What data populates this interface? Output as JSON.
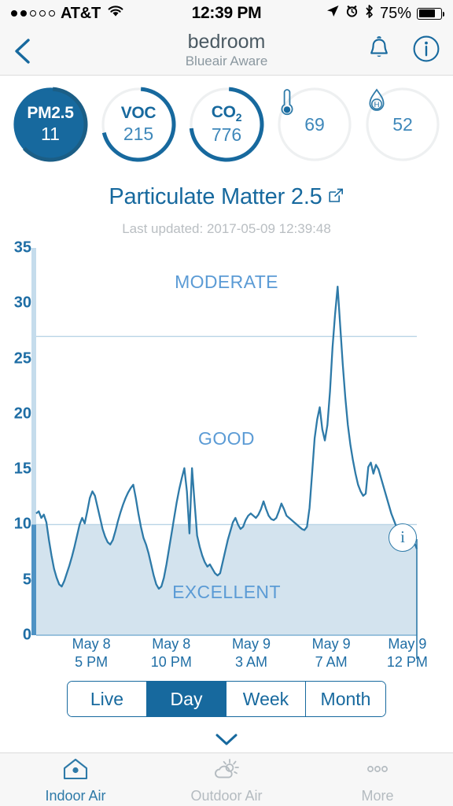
{
  "status_bar": {
    "carrier": "AT&T",
    "signal_dots_filled": 2,
    "signal_dots_total": 5,
    "time": "12:39 PM",
    "battery_percent": "75%",
    "battery_level": 75,
    "icons": [
      "location-arrow-icon",
      "alarm-clock-icon",
      "bluetooth-icon",
      "battery-icon"
    ]
  },
  "header": {
    "back_label": "",
    "title": "bedroom",
    "subtitle": "Blueair Aware",
    "bell_label": "",
    "info_label": ""
  },
  "metrics": [
    {
      "label": "PM2.5",
      "value": "11",
      "active": true,
      "arc": 0.62,
      "icon": null
    },
    {
      "label": "VOC",
      "value": "215",
      "active": false,
      "arc": 0.7,
      "icon": null
    },
    {
      "label": "CO",
      "sub": "2",
      "value": "776",
      "active": false,
      "arc": 0.72,
      "icon": null
    },
    {
      "label": "",
      "value": "69",
      "active": false,
      "arc": 0,
      "icon": "thermometer-icon"
    },
    {
      "label": "",
      "value": "52",
      "active": false,
      "arc": 0,
      "icon": "humidity-droplet-icon"
    }
  ],
  "chart_header": {
    "title": "Particulate Matter 2.5",
    "external_link_icon": "external-link-icon",
    "last_updated": "Last updated: 2017-05-09 12:39:48"
  },
  "chart_data": {
    "type": "area",
    "title": "Particulate Matter 2.5",
    "xlabel": "",
    "ylabel": "",
    "ylim": [
      0,
      35
    ],
    "yticks": [
      0,
      5,
      10,
      15,
      20,
      25,
      30,
      35
    ],
    "grid": true,
    "gridlines": [
      10,
      27
    ],
    "xtick_labels": [
      {
        "date": "May 8",
        "time": "5 PM",
        "x": 0.145
      },
      {
        "date": "May 8",
        "time": "10 PM",
        "x": 0.355
      },
      {
        "date": "May 9",
        "time": "3 AM",
        "x": 0.565
      },
      {
        "date": "May 9",
        "time": "7 AM",
        "x": 0.775
      },
      {
        "date": "May 9",
        "time": "12 PM",
        "x": 0.975
      }
    ],
    "bands": [
      {
        "label": "MODERATE",
        "min": 27,
        "max": 35
      },
      {
        "label": "GOOD",
        "min": 10,
        "max": 27
      },
      {
        "label": "EXCELLENT",
        "min": 0,
        "max": 10
      }
    ],
    "series_name": "PM2.5",
    "values": [
      11.0,
      11.2,
      10.6,
      10.9,
      10.2,
      8.6,
      7.2,
      6.0,
      5.2,
      4.6,
      4.4,
      4.9,
      5.6,
      6.3,
      7.1,
      8.0,
      9.0,
      10.0,
      10.6,
      10.1,
      11.2,
      12.4,
      13.0,
      12.6,
      11.6,
      10.6,
      9.6,
      8.9,
      8.4,
      8.2,
      8.6,
      9.4,
      10.3,
      11.1,
      11.8,
      12.4,
      12.9,
      13.3,
      13.6,
      12.4,
      11.0,
      9.8,
      8.8,
      8.2,
      7.4,
      6.4,
      5.4,
      4.6,
      4.2,
      4.4,
      5.2,
      6.4,
      7.8,
      9.2,
      10.6,
      12.0,
      13.2,
      14.2,
      15.1,
      13.0,
      9.2,
      15.1,
      12.0,
      9.0,
      8.0,
      7.2,
      6.6,
      6.2,
      6.4,
      6.0,
      5.6,
      5.4,
      5.6,
      6.6,
      7.6,
      8.6,
      9.4,
      10.2,
      10.6,
      10.0,
      9.6,
      9.8,
      10.4,
      10.8,
      11.0,
      10.8,
      10.6,
      10.9,
      11.4,
      12.1,
      11.4,
      10.8,
      10.5,
      10.4,
      10.6,
      11.2,
      11.9,
      11.4,
      10.8,
      10.6,
      10.4,
      10.2,
      10.0,
      9.8,
      9.6,
      9.5,
      9.8,
      11.5,
      14.6,
      17.8,
      19.5,
      20.6,
      18.6,
      17.6,
      19.0,
      22.0,
      26.0,
      29.0,
      31.5,
      28.0,
      24.5,
      21.5,
      19.0,
      17.2,
      15.8,
      14.6,
      13.6,
      13.0,
      12.6,
      12.8,
      15.2,
      15.6,
      14.6,
      15.4,
      15.0,
      14.2,
      13.4,
      12.6,
      11.8,
      11.0,
      10.4,
      9.8,
      9.2,
      8.8,
      8.5,
      8.2,
      8.6,
      9.0,
      8.4,
      7.8
    ],
    "marker": {
      "label": "i",
      "x_index": 149,
      "value": 8.4
    }
  },
  "range_selector": {
    "options": [
      "Live",
      "Day",
      "Week",
      "Month"
    ],
    "selected": "Day"
  },
  "expand_chevron_icon": "chevron-down-icon",
  "tabbar": [
    {
      "label": "Indoor Air",
      "icon": "house-icon",
      "active": true
    },
    {
      "label": "Outdoor Air",
      "icon": "cloud-sun-icon",
      "active": false
    },
    {
      "label": "More",
      "icon": "ellipsis-icon",
      "active": false
    }
  ]
}
